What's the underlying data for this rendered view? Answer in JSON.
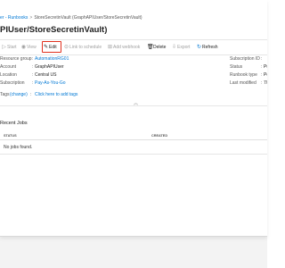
{
  "breadcrumb": {
    "items": [
      "er - Runbooks",
      "StoreSecretinVault (GraphAPIUser/StoreSecretinVault)"
    ],
    "separator": ">"
  },
  "page_title": "PIUser/StoreSecretinVault)",
  "toolbar": {
    "start": "Start",
    "view": "View",
    "edit": "Edit",
    "link_to_schedule": "Link to schedule",
    "add_webhook": "Add webhook",
    "delete": "Delete",
    "export": "Export",
    "refresh": "Refresh"
  },
  "properties_left": [
    {
      "label": "Resource group",
      "sep": ":",
      "value": "AutomationRG01",
      "link": true
    },
    {
      "label": "Account",
      "sep": ":",
      "value": "GraphAPIUser",
      "link": false
    },
    {
      "label": "Location",
      "sep": ":",
      "value": "Central US",
      "link": false
    },
    {
      "label": "Subscription",
      "sep": ":",
      "value": "Pay-As-You-Go",
      "link": true
    }
  ],
  "properties_right": [
    {
      "label": "Subscription ID",
      "sep": ":"
    },
    {
      "label": "Status",
      "sep": ":",
      "value": "Pu"
    },
    {
      "label": "Runbook type",
      "sep": ":",
      "value": "Po"
    },
    {
      "label": "Last modified",
      "sep": ":",
      "value": "7/"
    }
  ],
  "tags": {
    "label": "Tags",
    "change": "(change)",
    "sep": ":",
    "value": "Click here to add tags"
  },
  "recent_jobs": {
    "title": "Recent Jobs",
    "columns": [
      "STATUS",
      "CREATED"
    ],
    "empty": "No jobs found."
  },
  "colors": {
    "accent": "#0078d4",
    "highlight": "#e0301e"
  },
  "icons": [
    "start-icon",
    "view-icon",
    "edit-icon",
    "link-icon",
    "webhook-icon",
    "delete-icon",
    "export-icon",
    "refresh-icon",
    "collapse-icon"
  ]
}
